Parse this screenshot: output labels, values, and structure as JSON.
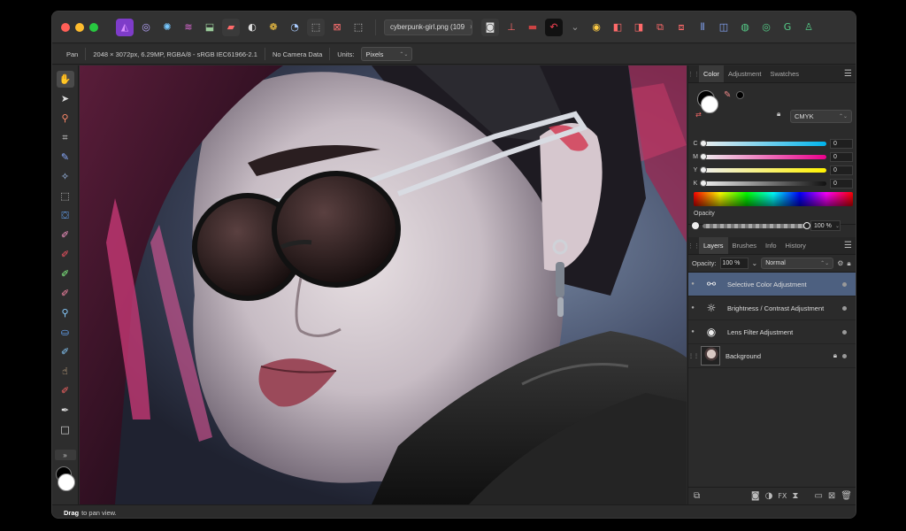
{
  "titlebar": {
    "document_tab": "cyberpunk-girl.png (109",
    "document_tab_close": "×",
    "buttons": [
      {
        "name": "persona-photo-button",
        "glyph": "◭",
        "color": "#d98cff",
        "bg": "#7e3cc9"
      },
      {
        "name": "persona-liquify-button",
        "glyph": "◎",
        "color": "#b8a6ff",
        "bg": "transparent"
      },
      {
        "name": "persona-develop-button",
        "glyph": "✺",
        "color": "#77c8ff",
        "bg": "transparent"
      },
      {
        "name": "persona-tone-mapping-button",
        "glyph": "≋",
        "color": "#e06ad8",
        "bg": "transparent"
      },
      {
        "name": "persona-export-button",
        "glyph": "⬓",
        "color": "#9acb9a",
        "bg": "transparent"
      },
      {
        "name": "auto-levels-button",
        "glyph": "▰",
        "color": "#ff6a6a",
        "bg": "#3a3a3a"
      },
      {
        "name": "auto-contrast-button",
        "glyph": "◐",
        "color": "#dddddd",
        "bg": "transparent"
      },
      {
        "name": "auto-colors-button",
        "glyph": "❁",
        "color": "#ffcc44",
        "bg": "transparent"
      },
      {
        "name": "auto-white-balance-button",
        "glyph": "◔",
        "color": "#aaccff",
        "bg": "transparent"
      },
      {
        "name": "marquee-select-button",
        "glyph": "⬚",
        "color": "#bbbbbb",
        "bg": "#3a3a3a"
      },
      {
        "name": "deselect-button",
        "glyph": "⊠",
        "color": "#ff7070",
        "bg": "transparent"
      },
      {
        "name": "invert-selection-button",
        "glyph": "⬚",
        "color": "#cccccc",
        "bg": "transparent"
      }
    ],
    "right_buttons": [
      {
        "name": "quick-mask-button",
        "glyph": "◙",
        "color": "#dddddd",
        "bg": "#3a3a3a"
      },
      {
        "name": "snapping-button",
        "glyph": "⊥",
        "color": "#ff6a6a",
        "bg": "transparent"
      },
      {
        "name": "toggle-overlay-button",
        "glyph": "▬",
        "color": "#cc4444",
        "bg": "transparent"
      },
      {
        "name": "assistant-button",
        "glyph": "↶",
        "color": "#ff4455",
        "bg": "#111111"
      },
      {
        "name": "chevron-down-icon",
        "glyph": "⌄",
        "color": "#999999",
        "bg": "transparent"
      },
      {
        "name": "chat-bubble-button",
        "glyph": "◉",
        "color": "#ffcc44",
        "bg": "transparent"
      },
      {
        "name": "arrange-back-button",
        "glyph": "◧",
        "color": "#ff6a6a",
        "bg": "transparent"
      },
      {
        "name": "arrange-forward-button",
        "glyph": "◨",
        "color": "#ff6a6a",
        "bg": "transparent"
      },
      {
        "name": "boolean-add-button",
        "glyph": "⧉",
        "color": "#ff6a6a",
        "bg": "transparent"
      },
      {
        "name": "boolean-subtract-button",
        "glyph": "⧈",
        "color": "#ff6a6a",
        "bg": "transparent"
      },
      {
        "name": "align-button",
        "glyph": "⫴",
        "color": "#88aaff",
        "bg": "transparent"
      },
      {
        "name": "studio-panels-button",
        "glyph": "◫",
        "color": "#88aaff",
        "bg": "transparent"
      },
      {
        "name": "studio-chat-button",
        "glyph": "◍",
        "color": "#55cc88",
        "bg": "transparent"
      },
      {
        "name": "studio-stack-button",
        "glyph": "◎",
        "color": "#55cc88",
        "bg": "transparent"
      },
      {
        "name": "studio-share-button",
        "glyph": "G",
        "color": "#55cc88",
        "bg": "transparent"
      },
      {
        "name": "user-account-button",
        "glyph": "♙",
        "color": "#55cc88",
        "bg": "transparent"
      }
    ]
  },
  "contextbar": {
    "tool_name": "Pan",
    "image_info": "2048 × 3072px, 6.29MP, RGBA/8 - sRGB IEC61966-2.1",
    "camera_info": "No Camera Data",
    "units_label": "Units:",
    "units_value": "Pixels",
    "chevron": "⌃⌄"
  },
  "tools": [
    {
      "name": "view-tool",
      "glyph": "✋",
      "color": "#f0c89a"
    },
    {
      "name": "move-tool",
      "glyph": "➤",
      "color": "#dddddd"
    },
    {
      "name": "color-picker-tool",
      "glyph": "⚲",
      "color": "#ff8a6a"
    },
    {
      "name": "crop-tool",
      "glyph": "⌗",
      "color": "#dddddd"
    },
    {
      "name": "selection-brush-tool",
      "glyph": "✎",
      "color": "#88aaff"
    },
    {
      "name": "flood-select-tool",
      "glyph": "✧",
      "color": "#aaccff"
    },
    {
      "name": "marquee-tool",
      "glyph": "⬚",
      "color": "#cccccc"
    },
    {
      "name": "flood-fill-tool",
      "glyph": "⛋",
      "color": "#66aaff"
    },
    {
      "name": "paint-brush-tool",
      "glyph": "✐",
      "color": "#ff99cc"
    },
    {
      "name": "color-replacement-tool",
      "glyph": "✐",
      "color": "#ff5566"
    },
    {
      "name": "paint-mixer-tool",
      "glyph": "✐",
      "color": "#88ff88"
    },
    {
      "name": "erase-brush-tool",
      "glyph": "✐",
      "color": "#ff88aa"
    },
    {
      "name": "dodge-tool",
      "glyph": "⚲",
      "color": "#88ccff"
    },
    {
      "name": "clone-tool",
      "glyph": "⛀",
      "color": "#66aaff"
    },
    {
      "name": "blemish-removal-tool",
      "glyph": "✐",
      "color": "#88ccff"
    },
    {
      "name": "smudge-tool",
      "glyph": "☝",
      "color": "#f0c89a"
    },
    {
      "name": "red-eye-tool",
      "glyph": "✐",
      "color": "#ff6666"
    },
    {
      "name": "pen-tool",
      "glyph": "✒",
      "color": "#dddddd"
    },
    {
      "name": "rectangle-tool",
      "glyph": "□",
      "color": "#dddddd"
    }
  ],
  "toolbox_expand": "»",
  "statusbar": {
    "bold": "Drag",
    "rest": "to pan view."
  },
  "color_panel": {
    "tabs": [
      "Color",
      "Adjustment",
      "Swatches"
    ],
    "active_tab": 0,
    "mode": "CMYK",
    "sliders": [
      {
        "label": "C",
        "value": "0",
        "gradient": "linear-gradient(to right,#eee,#00b3ec)"
      },
      {
        "label": "M",
        "value": "0",
        "gradient": "linear-gradient(to right,#eee,#ec008c)"
      },
      {
        "label": "Y",
        "value": "0",
        "gradient": "linear-gradient(to right,#eee,#fff200)"
      },
      {
        "label": "K",
        "value": "0",
        "gradient": "linear-gradient(to right,#eee,#111)"
      }
    ],
    "opacity_label": "Opacity",
    "opacity_value": "100 %"
  },
  "layers_panel": {
    "tabs": [
      "Layers",
      "Brushes",
      "Info",
      "History"
    ],
    "active_tab": 0,
    "opacity_label": "Opacity:",
    "opacity_value": "100 %",
    "blend_mode": "Normal",
    "layers": [
      {
        "name": "Selective Color Adjustment",
        "icon": "⚯",
        "selected": true,
        "locked": false
      },
      {
        "name": "Brightness / Contrast Adjustment",
        "icon": "☼",
        "selected": false,
        "locked": false
      },
      {
        "name": "Lens Filter Adjustment",
        "icon": "◉",
        "selected": false,
        "locked": false
      },
      {
        "name": "Background",
        "icon": "",
        "selected": false,
        "locked": true
      }
    ]
  },
  "colors": {
    "accent_selected": "#4d6080",
    "window_bg": "#2b2b2b"
  }
}
